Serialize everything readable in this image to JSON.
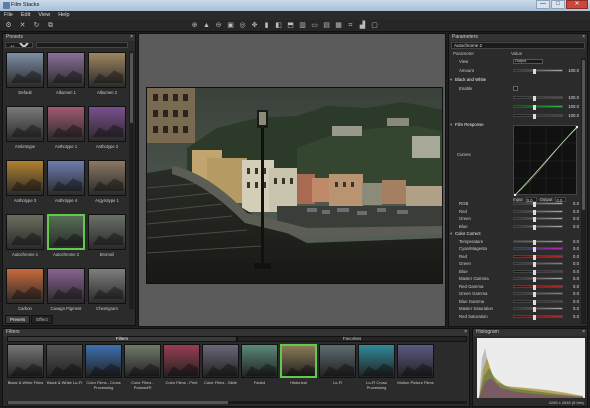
{
  "window": {
    "title": "Film Stacks",
    "controls": [
      "—",
      "□",
      "✕"
    ]
  },
  "menu": [
    "File",
    "Edit",
    "View",
    "Help"
  ],
  "toolbar": {
    "left_icons": [
      "gear-icon",
      "close-icon",
      "refresh-icon",
      "compare-icon"
    ],
    "center_icons": [
      "zoom-in-icon",
      "landscape-icon",
      "zoom-out-icon",
      "fit-icon",
      "zoom-100-icon",
      "hand-icon",
      "single-view-icon",
      "split-vertical-icon",
      "split-horizontal-icon",
      "side-by-side-icon",
      "open-icon",
      "save-icon",
      "export-icon",
      "crop-icon",
      "histogram-icon",
      "fullscreen-icon"
    ]
  },
  "presets": {
    "header": "Presets",
    "filter_option": "All",
    "search_placeholder": "",
    "items": [
      {
        "label": "Default",
        "tint": "#7d8fa6"
      },
      {
        "label": "Albumen 1",
        "tint": "#8a6f9a"
      },
      {
        "label": "Albumen 2",
        "tint": "#9d8560"
      },
      {
        "label": "Ambrotype",
        "tint": "#7a7a7a"
      },
      {
        "label": "Anthotype 1",
        "tint": "#a05a72"
      },
      {
        "label": "Anthotype 2",
        "tint": "#7a4f8f"
      },
      {
        "label": "Anthotype 3",
        "tint": "#b2822e"
      },
      {
        "label": "Anthotype 4",
        "tint": "#6c7cae"
      },
      {
        "label": "Argyrotype 1",
        "tint": "#8a7862"
      },
      {
        "label": "Autochrome 1",
        "tint": "#6c6c5e"
      },
      {
        "label": "Autochrome 2",
        "tint": "#556f55",
        "selected": true
      },
      {
        "label": "Bromoil",
        "tint": "#6a7068"
      },
      {
        "label": "Carbon",
        "tint": "#c96a3a"
      },
      {
        "label": "Cavagn Pigment",
        "tint": "#8a6292"
      },
      {
        "label": "Chemigram",
        "tint": "#7e7e7e"
      }
    ],
    "tabs": [
      "Presets",
      "Effect"
    ],
    "active_tab": "Presets"
  },
  "parameters": {
    "header": "Parameters",
    "preset_name": "Autochrome 2",
    "col_parameter": "Parameter",
    "col_value": "Value",
    "rows": [
      {
        "name": "View",
        "type": "dropdown",
        "value": "Output"
      },
      {
        "name": "Amount",
        "type": "slider",
        "color": "gray",
        "value": "100.0"
      },
      {
        "name": "Black and White",
        "type": "section"
      },
      {
        "name": "Enable",
        "type": "checkbox"
      },
      {
        "name": "",
        "type": "slider",
        "color": "red",
        "value": "100.0"
      },
      {
        "name": "",
        "type": "slider",
        "color": "green",
        "value": "100.0"
      },
      {
        "name": "",
        "type": "slider",
        "color": "blue",
        "value": "100.0"
      },
      {
        "name": "Film Response",
        "type": "section"
      },
      {
        "name": "",
        "type": "dropdown",
        "value": "RGB"
      }
    ],
    "curves_label": "Curves",
    "curve_io": {
      "input": "Input",
      "output": "Output",
      "input_value": "0.0",
      "output_value": "0.0"
    },
    "rows2": [
      {
        "name": "RGB",
        "value": "0.0"
      },
      {
        "name": "Red",
        "value": "0.0"
      },
      {
        "name": "Green",
        "value": "0.0"
      },
      {
        "name": "Blue",
        "value": "0.0"
      },
      {
        "name": "Color Correct",
        "section": true
      },
      {
        "name": "Temperature",
        "color": "warm",
        "value": "0.0"
      },
      {
        "name": "Cyan/Magenta",
        "color": "cyan",
        "value": "0.0"
      },
      {
        "name": "Red",
        "color": "red",
        "value": "0.0"
      },
      {
        "name": "Green",
        "color": "green",
        "value": "0.0"
      },
      {
        "name": "Blue",
        "color": "blue",
        "value": "0.0"
      },
      {
        "name": "Master Gamma",
        "color": "gray",
        "value": "0.0"
      },
      {
        "name": "Red Gamma",
        "color": "red",
        "value": "0.0"
      },
      {
        "name": "Green Gamma",
        "color": "green",
        "value": "0.0"
      },
      {
        "name": "Blue Gamma",
        "color": "blue",
        "value": "0.0"
      },
      {
        "name": "Master Saturation",
        "color": "gray",
        "value": "0.0"
      },
      {
        "name": "Red Saturation",
        "color": "red",
        "value": "0.0"
      }
    ]
  },
  "filters": {
    "header": "Filters",
    "tabs": [
      "Filters",
      "Favorites"
    ],
    "active_tab": "Filters",
    "items": [
      {
        "label": "Black & White Films",
        "tint": "#777777"
      },
      {
        "label": "Black & White Lo-Fi",
        "tint": "#555555"
      },
      {
        "label": "Color Films - Cross Processing",
        "tint": "#3d6fb0"
      },
      {
        "label": "Color Films - Polaroid®",
        "tint": "#707a6a"
      },
      {
        "label": "Color Films - Print",
        "tint": "#9a3d52"
      },
      {
        "label": "Color Films - Slide",
        "tint": "#6a6878"
      },
      {
        "label": "Faded",
        "tint": "#5a8a78"
      },
      {
        "label": "Historical",
        "tint": "#8a7a55",
        "selected": true
      },
      {
        "label": "Lo-Fi",
        "tint": "#5e6a72"
      },
      {
        "label": "Lo-Fi Cross Processing",
        "tint": "#2f8a9a"
      },
      {
        "label": "Motion Picture Films",
        "tint": "#5a5a82"
      }
    ]
  },
  "histogram": {
    "header": "Histogram",
    "resolution": "4288 x 2848 (8 bits)"
  },
  "colors": {
    "panel": "#2b2b2b",
    "selection": "#62c84e",
    "viewer_bg": "#5b5b5b"
  }
}
